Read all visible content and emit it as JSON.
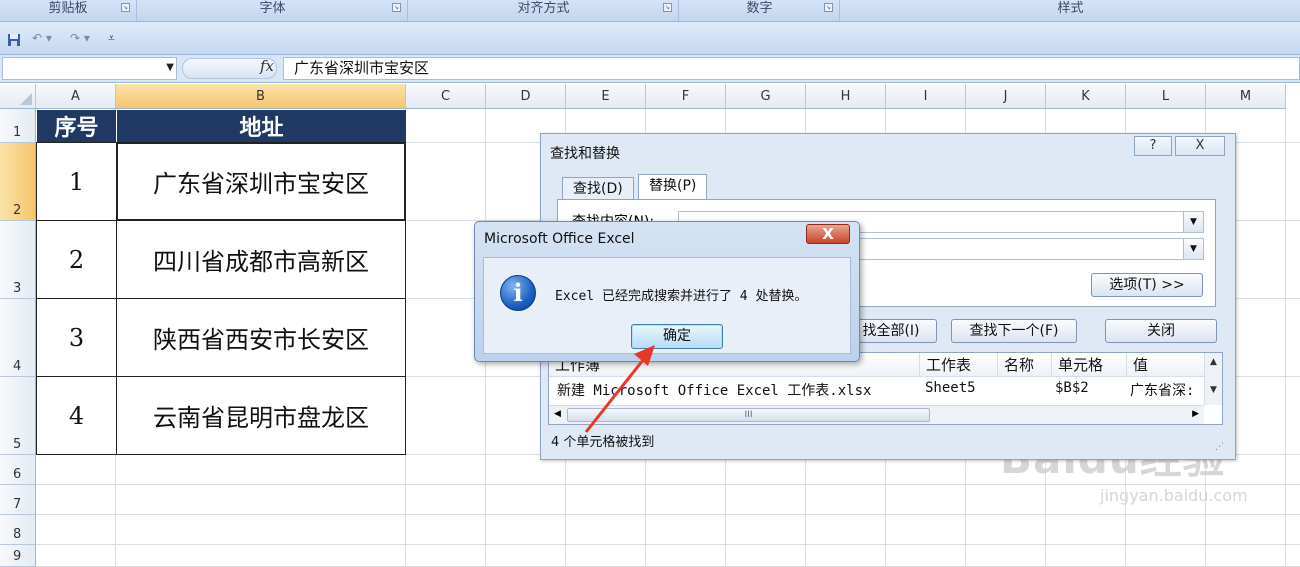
{
  "ribbon": {
    "groups": [
      "剪贴板",
      "字体",
      "对齐方式",
      "数字",
      "样式"
    ]
  },
  "quick_access": {
    "icons": [
      "save-icon",
      "undo-icon",
      "redo-icon",
      "customize-icon"
    ]
  },
  "formula_bar": {
    "name_box": "",
    "fx_label": "fx",
    "content": "广东省深圳市宝安区"
  },
  "grid": {
    "columns": [
      "A",
      "B",
      "C",
      "D",
      "E",
      "F",
      "G",
      "H",
      "I",
      "J",
      "K",
      "L",
      "M"
    ],
    "selected_column": "B",
    "rows": [
      "1",
      "2",
      "3",
      "4",
      "5",
      "6",
      "7",
      "8",
      "9"
    ],
    "selected_row": "2",
    "header": {
      "a": "序号",
      "b": "地址"
    },
    "data": [
      {
        "a": "1",
        "b": "广东省深圳市宝安区"
      },
      {
        "a": "2",
        "b": "四川省成都市高新区"
      },
      {
        "a": "3",
        "b": "陕西省西安市长安区"
      },
      {
        "a": "4",
        "b": "云南省昆明市盘龙区"
      }
    ]
  },
  "find_replace": {
    "title": "查找和替换",
    "help": "?",
    "close": "X",
    "tab_find": "查找(D)",
    "tab_replace": "替换(P)",
    "find_label": "查找内容(N):",
    "options_button": "选项(T) >>",
    "replace_all_partial": "找全部(I)",
    "find_next": "查找下一个(F)",
    "close_button": "关闭",
    "result_headers": [
      "工作簿",
      "工作表",
      "名称",
      "单元格",
      "值"
    ],
    "result_row": {
      "workbook": "新建 Microsoft Office Excel 工作表.xlsx",
      "sheet": "Sheet5",
      "name": "",
      "cell": "$B$2",
      "value": "广东省深:"
    },
    "status": "4 个单元格被找到"
  },
  "message_box": {
    "title": "Microsoft Office Excel",
    "close": "X",
    "text": "Excel 已经完成搜索并进行了 4 处替换。",
    "ok": "确定"
  },
  "watermark": {
    "brand": "Baidu经验",
    "url": "jingyan.baidu.com"
  },
  "colors": {
    "header_fill": "#1f3864",
    "selected_header": "#f5c56a",
    "arrow": "#e8372a"
  }
}
